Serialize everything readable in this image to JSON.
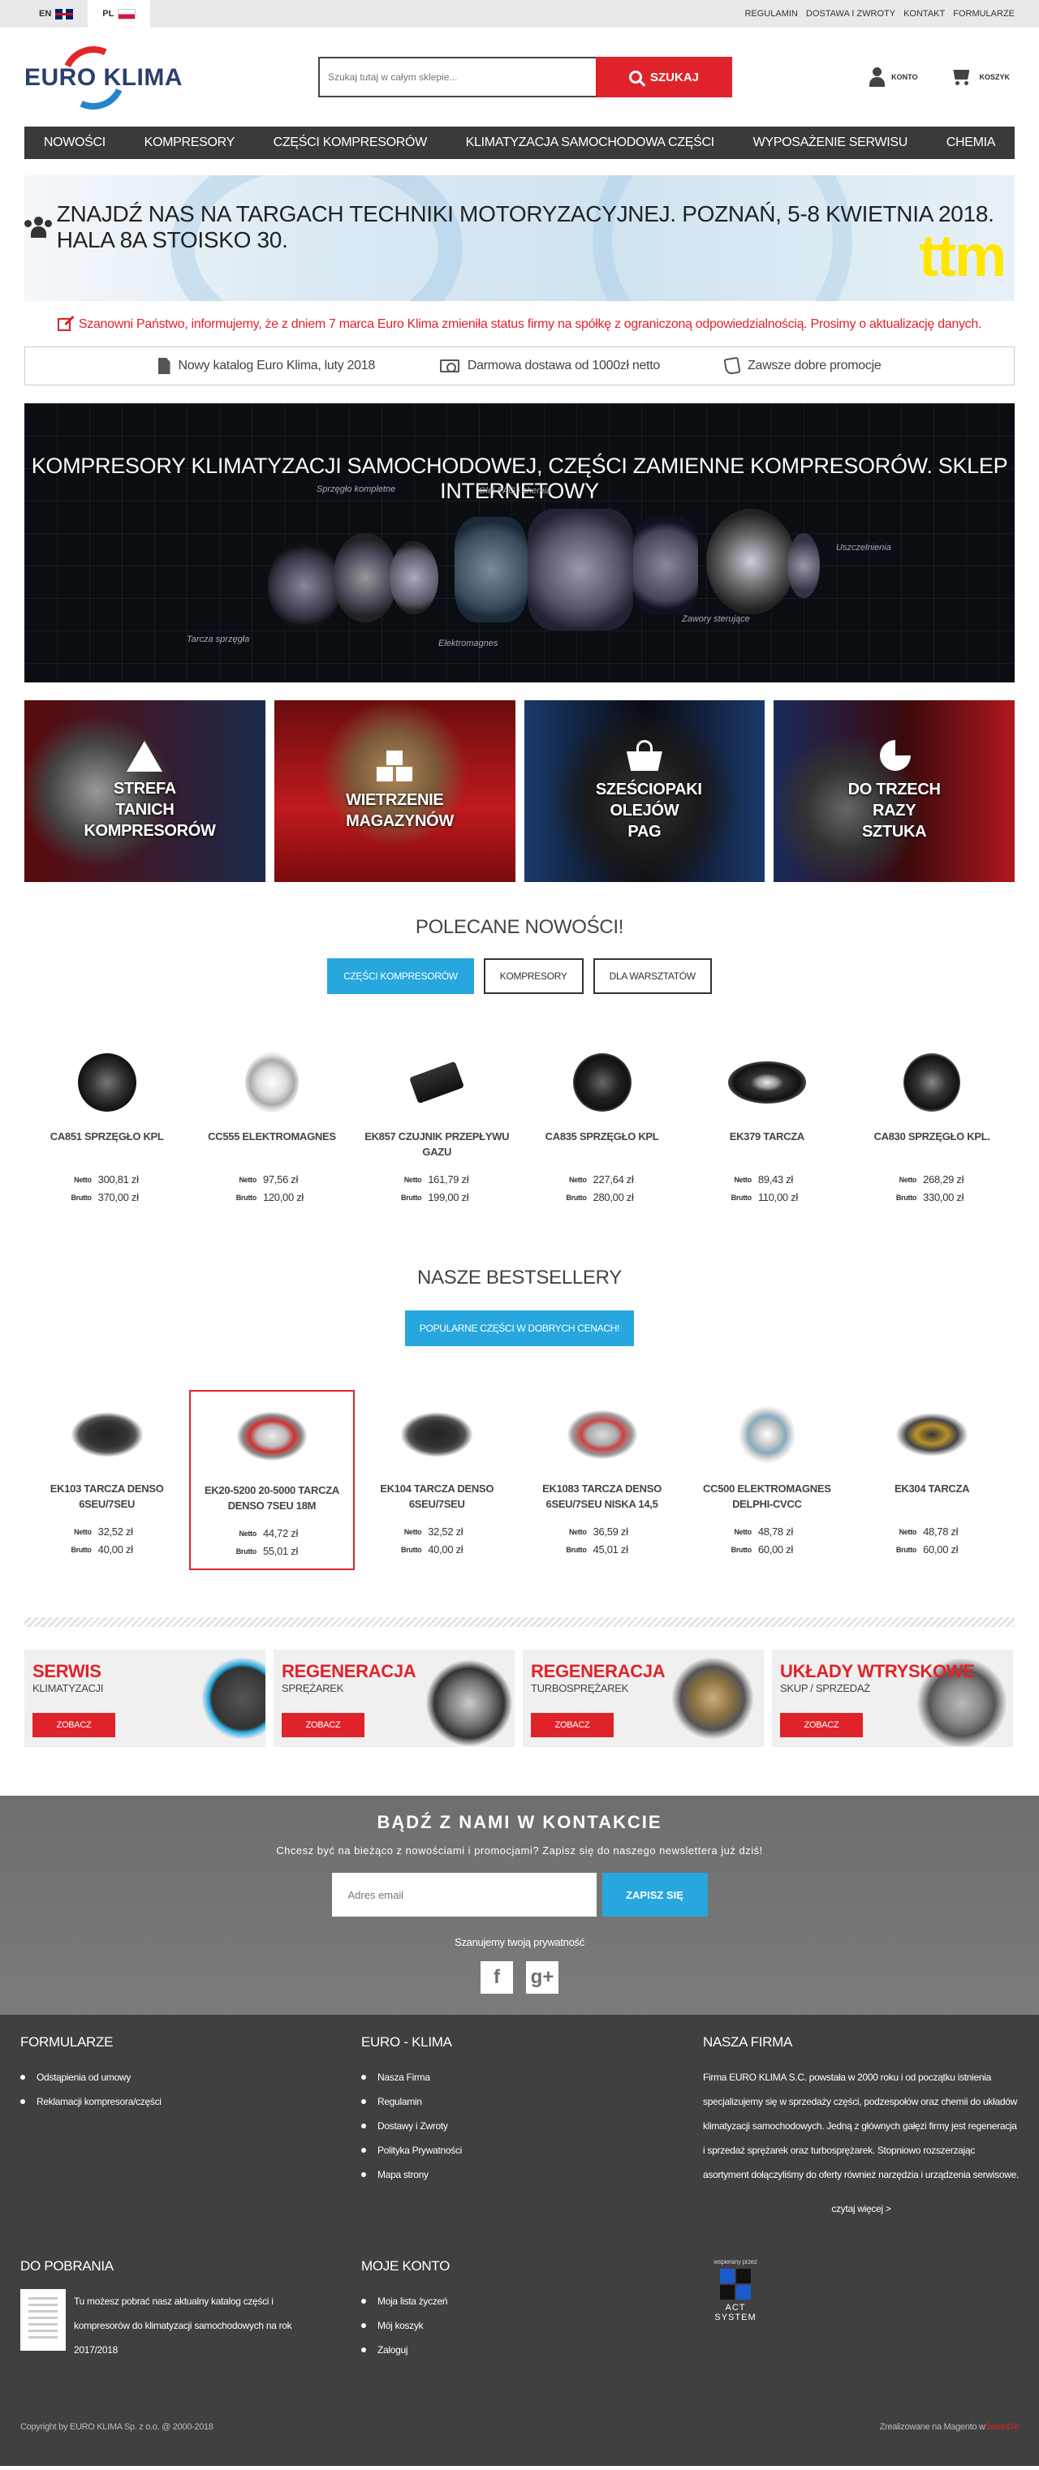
{
  "topbar": {
    "langs": [
      {
        "code": "EN",
        "active": false
      },
      {
        "code": "PL",
        "active": true
      }
    ],
    "links": [
      "REGULAMIN",
      "DOSTAWA I ZWROTY",
      "KONTAKT",
      "FORMULARZE"
    ]
  },
  "header": {
    "logo_text": "EURO KLIMA",
    "search_placeholder": "Szukaj tutaj w całym sklepie...",
    "search_button": "SZUKAJ",
    "account": "KONTO",
    "cart": "KOSZYK"
  },
  "nav": [
    "NOWOŚCI",
    "KOMPRESORY",
    "CZĘŚCI KOMPRESORÓW",
    "KLIMATYZACJA SAMOCHODOWA CZĘŚCI",
    "WYPOSAŻENIE SERWISU",
    "CHEMIA"
  ],
  "promo": {
    "text": "ZNAJDŹ NAS NA TARGACH TECHNIKI MOTORYZACYJNEJ. POZNAŃ, 5-8 KWIETNIA 2018. HALA 8A STOISKO 30.",
    "logo": "ttm"
  },
  "notice": "Szanowni Państwo, informujemy, że z dniem 7 marca Euro Klima zmieniła status firmy na spółkę z ograniczoną odpowiedzialnością. Prosimy o aktualizację danych.",
  "infobar": [
    "Nowy katalog Euro Klima, luty 2018",
    "Darmowa dostawa od 1000zł netto",
    "Zawsze dobre promocje"
  ],
  "hero": {
    "title": "KOMPRESORY KLIMATYZACJI SAMOCHODOWEJ, CZĘŚCI ZAMIENNE KOMPRESORÓW. SKLEP INTERNETOWY",
    "labels": [
      "Sprzęgło kompletne",
      "Olej PAG i chemia",
      "Uszczelnienia",
      "Tarcza sprzęgła",
      "Elektromagnes",
      "Zawory sterujące"
    ]
  },
  "tiles": [
    {
      "title": "STREFA TANICH KOMPRESORÓW",
      "icon": "warning-icon"
    },
    {
      "title": "WIETRZENIE MAGAZYNÓW",
      "icon": "boxes-icon"
    },
    {
      "title": "SZEŚCIOPAKI OLEJÓW PAG",
      "icon": "basket-icon"
    },
    {
      "title": "DO TRZECH RAZY SZTUKA",
      "icon": "pie-icon"
    }
  ],
  "new_section": {
    "title": "POLECANE NOWOŚCI!",
    "tabs": [
      "CZĘŚCI KOMPRESORÓW",
      "KOMPRESORY",
      "DLA WARSZTATÓW"
    ],
    "netto_label": "Netto",
    "brutto_label": "Brutto",
    "products": [
      {
        "name": "CA851 SPRZĘGŁO KPL",
        "netto": "300,81 zł",
        "brutto": "370,00 zł"
      },
      {
        "name": "CC555 ELEKTROMAGNES",
        "netto": "97,56 zł",
        "brutto": "120,00 zł"
      },
      {
        "name": "EK857 CZUJNIK PRZEPŁYWU GAZU",
        "netto": "161,79 zł",
        "brutto": "199,00 zł"
      },
      {
        "name": "CA835 SPRZĘGŁO KPL",
        "netto": "227,64 zł",
        "brutto": "280,00 zł"
      },
      {
        "name": "EK379 TARCZA",
        "netto": "89,43 zł",
        "brutto": "110,00 zł"
      },
      {
        "name": "CA830 SPRZĘGŁO KPL.",
        "netto": "268,29 zł",
        "brutto": "330,00 zł"
      }
    ]
  },
  "best_section": {
    "title": "NASZE BESTSELLERY",
    "button": "POPULARNE CZĘŚCI W DOBRYCH CENACH!",
    "products": [
      {
        "name": "EK103 TARCZA DENSO 6SEU/7SEU",
        "netto": "32,52 zł",
        "brutto": "40,00 zł"
      },
      {
        "name": "EK20-5200 20-5000 TARCZA DENSO 7SEU 18M",
        "netto": "44,72 zł",
        "brutto": "55,01 zł"
      },
      {
        "name": "EK104 TARCZA DENSO 6SEU/7SEU",
        "netto": "32,52 zł",
        "brutto": "40,00 zł"
      },
      {
        "name": "EK1083 TARCZA DENSO 6SEU/7SEU NISKA 14,5",
        "netto": "36,59 zł",
        "brutto": "45,01 zł"
      },
      {
        "name": "CC500 ELEKTROMAGNES DELPHI-CVCC",
        "netto": "48,78 zł",
        "brutto": "60,00 zł"
      },
      {
        "name": "EK304 TARCZA",
        "netto": "48,78 zł",
        "brutto": "60,00 zł"
      }
    ]
  },
  "services": [
    {
      "title": "SERWIS",
      "sub": "KLIMATYZACJI",
      "button": "ZOBACZ"
    },
    {
      "title": "REGENERACJA",
      "sub": "SPRĘŻAREK",
      "button": "ZOBACZ"
    },
    {
      "title": "REGENERACJA",
      "sub": "TURBOSPRĘŻAREK",
      "button": "ZOBACZ"
    },
    {
      "title": "UKŁADY WTRYSKOWE",
      "sub": "SKUP / SPRZEDAŻ",
      "button": "ZOBACZ"
    }
  ],
  "newsletter": {
    "title": "BĄDŹ Z NAMI W KONTAKCIE",
    "question": "Chcesz być na bieżąco z nowościami i promocjami? Zapisz się do naszego newslettera już dziś!",
    "placeholder": "Adres email",
    "button": "ZAPISZ SIĘ",
    "privacy": "Szanujemy twoją prywatność",
    "social": [
      "f",
      "g+"
    ]
  },
  "footer": {
    "formularze": {
      "title": "FORMULARZE",
      "items": [
        "Odstąpienia od umowy",
        "Reklamacji kompresora/części"
      ]
    },
    "euroklima": {
      "title": "EURO - KLIMA",
      "items": [
        "Nasza Firma",
        "Regulamin",
        "Dostawy i Zwroty",
        "Polityka Prywatności",
        "Mapa strony"
      ]
    },
    "firma": {
      "title": "NASZA FIRMA",
      "text": "Firma EURO KLIMA S.C. powstała w 2000 roku i od początku istnienia specjalizujemy się w sprzedaży części, podzespołów oraz chemii do układów klimatyzacji samochodowych. Jedną z głównych gałęzi firmy jest regeneracja i sprzedaż sprężarek oraz turbosprężarek. Stopniowo rozszerzając asortyment dołączyliśmy do oferty również narzędzia i urządzenia serwisowe.",
      "more": "czytaj więcej >"
    },
    "downloads": {
      "title": "DO POBRANIA",
      "text": "Tu możesz pobrać nasz aktualny katalog części i kompresorów do klimatyzacji samochodowych na rok 2017/2018"
    },
    "account": {
      "title": "MOJE KONTO",
      "items": [
        "Moja lista życzeń",
        "Mój koszyk",
        "Zaloguj"
      ]
    },
    "act": {
      "small": "wspierany przez",
      "brand": "ACT SYSTEM"
    },
    "copyright": "Copyright by EURO KLIMA Sp. z o.o. @ 2000-2018",
    "powered_prefix": "Zrealizowane na Magento w",
    "powered_brand": "SeeInGo"
  }
}
